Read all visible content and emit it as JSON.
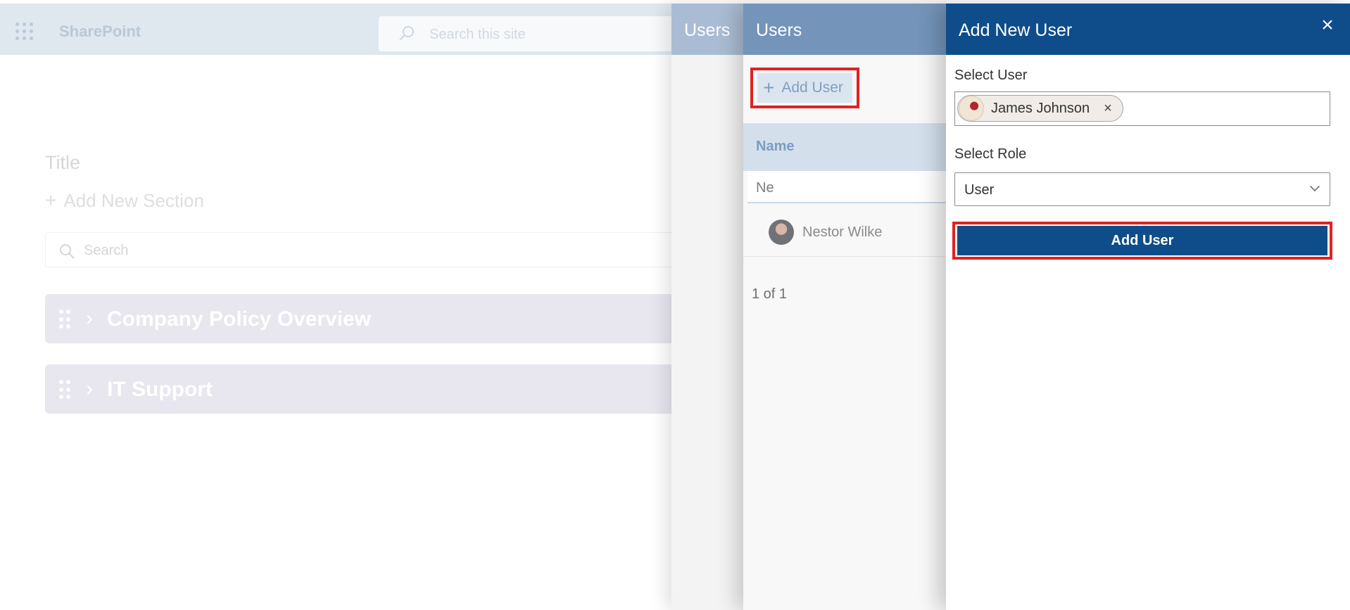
{
  "suite_bar": {
    "brand": "SharePoint",
    "search_placeholder": "Search this site"
  },
  "page": {
    "title": "Title",
    "add_section": "Add New Section",
    "search_placeholder": "Search",
    "accordions": [
      {
        "label": "Company Policy Overview"
      },
      {
        "label": "IT Support"
      }
    ]
  },
  "panel_users_narrow": {
    "title": "Users"
  },
  "panel_users": {
    "title": "Users",
    "add_user_label": "Add User",
    "column_name": "Name",
    "filter_value": "Ne",
    "rows": [
      {
        "name": "Nestor Wilke"
      }
    ],
    "pager": "1 of 1"
  },
  "panel_add_user": {
    "title": "Add New User",
    "select_user_label": "Select User",
    "selected_user": "James Johnson",
    "select_role_label": "Select Role",
    "selected_role": "User",
    "submit_label": "Add User"
  },
  "colors": {
    "primary": "#0f4d8a",
    "highlight": "#e02222",
    "panel_header_mid": "#7494b9"
  }
}
